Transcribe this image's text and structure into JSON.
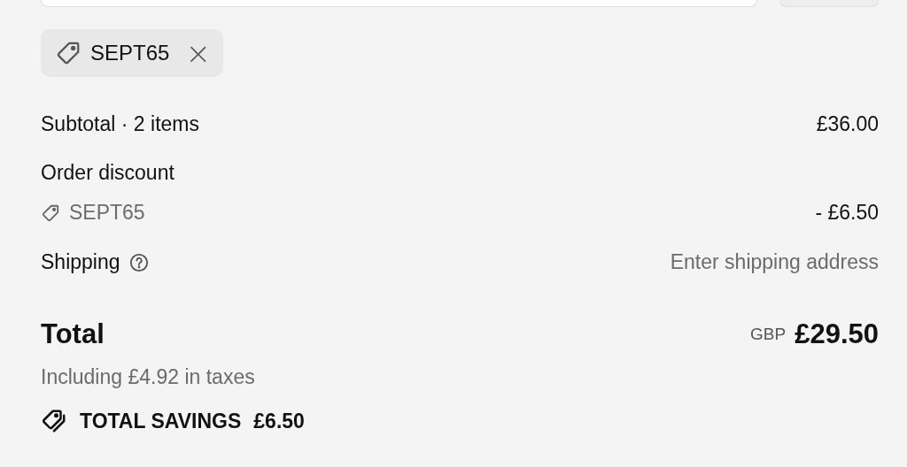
{
  "discount_code": {
    "code": "SEPT65",
    "remove": "×"
  },
  "subtotal": {
    "label": "Subtotal · 2 items",
    "value": "£36.00"
  },
  "order_discount": {
    "label": "Order discount",
    "code": "SEPT65",
    "value": "- £6.50"
  },
  "shipping": {
    "label": "Shipping",
    "value": "Enter shipping address"
  },
  "total": {
    "label": "Total",
    "currency": "GBP",
    "value": "£29.50",
    "taxes": "Including £4.92 in taxes"
  },
  "savings": {
    "label": "TOTAL SAVINGS",
    "value": "£6.50"
  }
}
